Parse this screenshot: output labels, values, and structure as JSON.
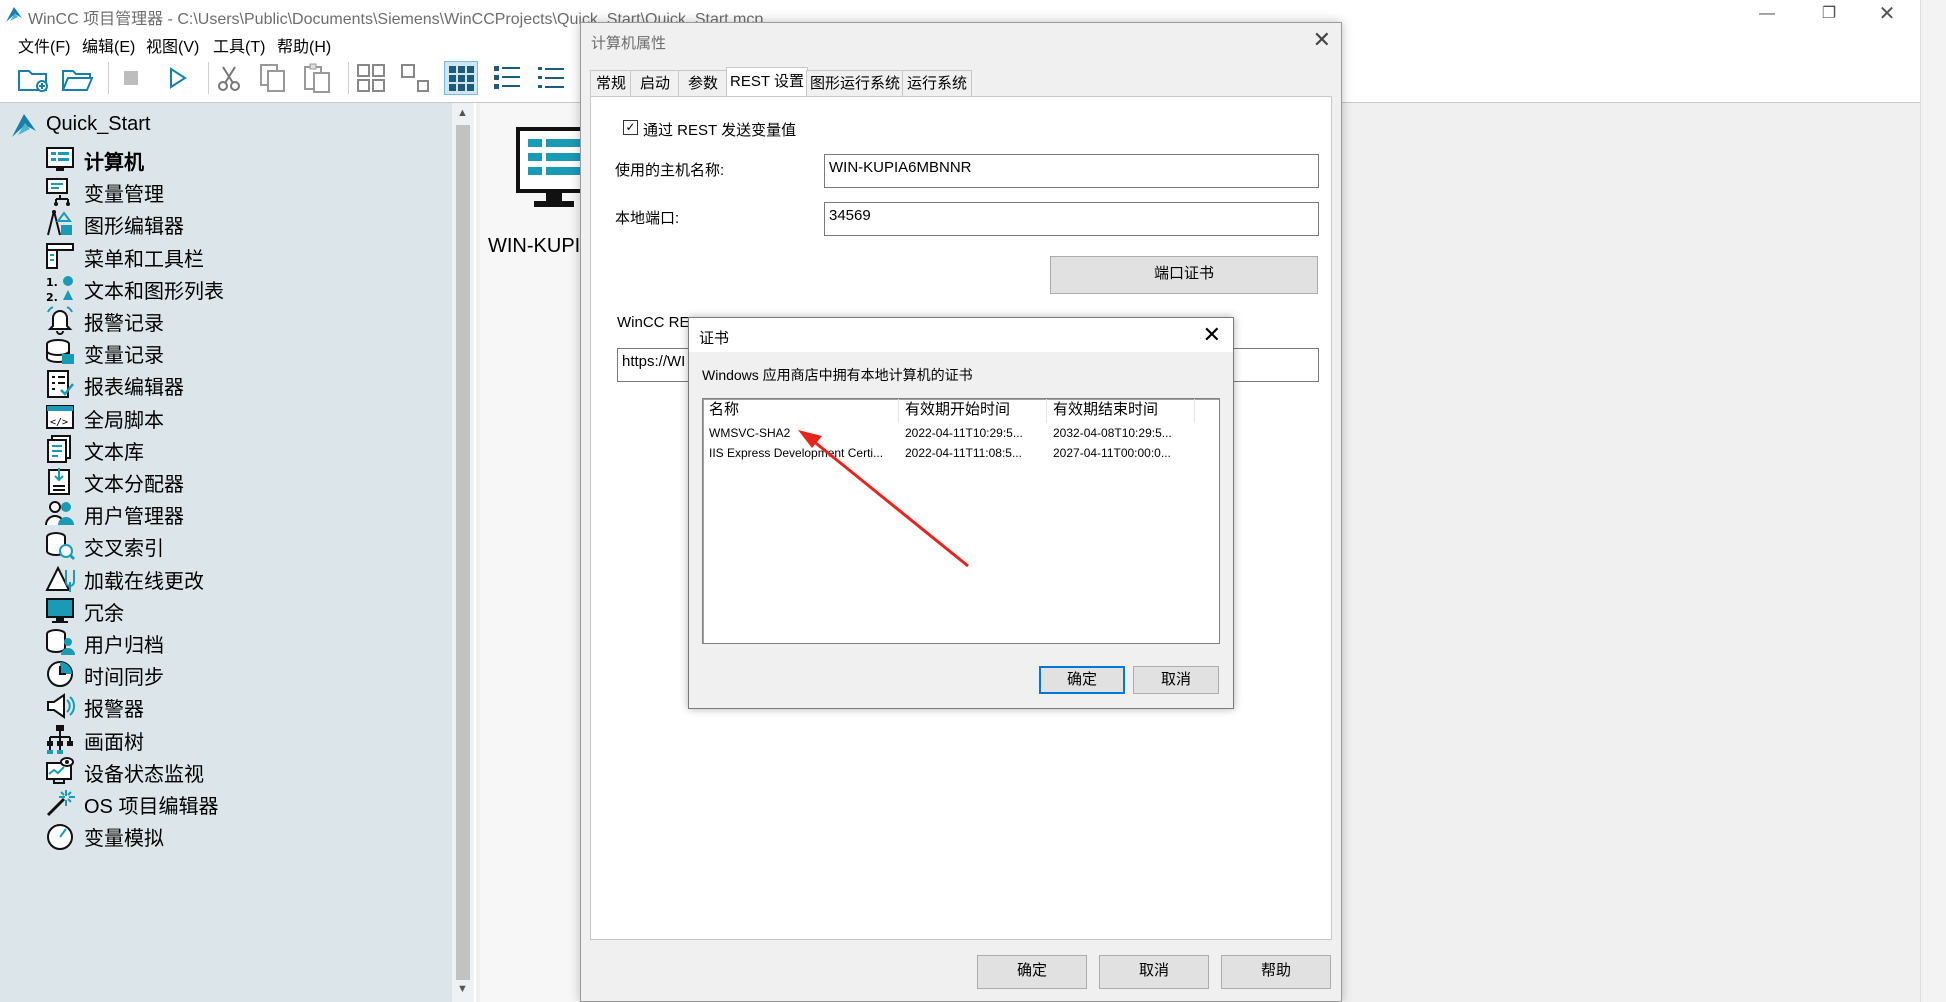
{
  "app": {
    "title": "WinCC 项目管理器 - C:\\Users\\Public\\Documents\\Siemens\\WinCCProjects\\Quick_Start\\Quick_Start.mcp"
  },
  "menu": [
    "文件(F)",
    "编辑(E)",
    "视图(V)",
    "工具(T)",
    "帮助(H)"
  ],
  "tree": {
    "root": "Quick_Start",
    "items": [
      {
        "label": "计算机",
        "icon": "computer-icon"
      },
      {
        "label": "变量管理",
        "icon": "tag-management-icon"
      },
      {
        "label": "图形编辑器",
        "icon": "graphics-designer-icon"
      },
      {
        "label": "菜单和工具栏",
        "icon": "menu-toolbar-icon"
      },
      {
        "label": "文本和图形列表",
        "icon": "text-graphic-list-icon"
      },
      {
        "label": "报警记录",
        "icon": "alarm-bell-icon"
      },
      {
        "label": "变量记录",
        "icon": "tag-logging-icon"
      },
      {
        "label": "报表编辑器",
        "icon": "report-designer-icon"
      },
      {
        "label": "全局脚本",
        "icon": "global-script-icon"
      },
      {
        "label": "文本库",
        "icon": "text-library-icon"
      },
      {
        "label": "文本分配器",
        "icon": "text-distributor-icon"
      },
      {
        "label": "用户管理器",
        "icon": "user-admin-icon"
      },
      {
        "label": "交叉索引",
        "icon": "cross-reference-icon"
      },
      {
        "label": "加载在线更改",
        "icon": "online-change-icon"
      },
      {
        "label": "冗余",
        "icon": "redundancy-icon"
      },
      {
        "label": "用户归档",
        "icon": "user-archive-icon"
      },
      {
        "label": "时间同步",
        "icon": "time-sync-icon"
      },
      {
        "label": "报警器",
        "icon": "horn-icon"
      },
      {
        "label": "画面树",
        "icon": "picture-tree-icon"
      },
      {
        "label": "设备状态监视",
        "icon": "device-monitor-icon"
      },
      {
        "label": "OS 项目编辑器",
        "icon": "os-project-editor-icon"
      },
      {
        "label": "变量模拟",
        "icon": "tag-simulation-icon"
      }
    ]
  },
  "content": {
    "node_label": "WIN-KUPIA"
  },
  "dialog": {
    "title": "计算机属性",
    "tabs": [
      "常规",
      "启动",
      "参数",
      "REST 设置",
      "图形运行系统",
      "运行系统"
    ],
    "active_tab": "REST 设置",
    "send_tag_values_label": "通过 REST 发送变量值",
    "send_tag_values_checked": true,
    "hostname_label": "使用的主机名称:",
    "hostname_value": "WIN-KUPIA6MBNNR",
    "port_label": "本地端口:",
    "port_value": "34569",
    "port_cert_button": "端口证书",
    "rest_label": "WinCC RES",
    "url_value": "https://WI",
    "ok": "确定",
    "cancel": "取消",
    "help": "帮助"
  },
  "cert_dialog": {
    "title": "证书",
    "description": "Windows 应用商店中拥有本地计算机的证书",
    "columns": [
      "名称",
      "有效期开始时间",
      "有效期结束时间"
    ],
    "rows": [
      [
        "WMSVC-SHA2",
        "2022-04-11T10:29:5...",
        "2032-04-08T10:29:5..."
      ],
      [
        "IIS Express Development Certi...",
        "2022-04-11T11:08:5...",
        "2027-04-11T00:00:0..."
      ]
    ],
    "ok": "确定",
    "cancel": "取消"
  },
  "colors": {
    "accent": "#0078d7",
    "tree_bg": "#dce6ea",
    "icon_teal": "#1a9bb5",
    "annotation_arrow": "#e8231c"
  }
}
